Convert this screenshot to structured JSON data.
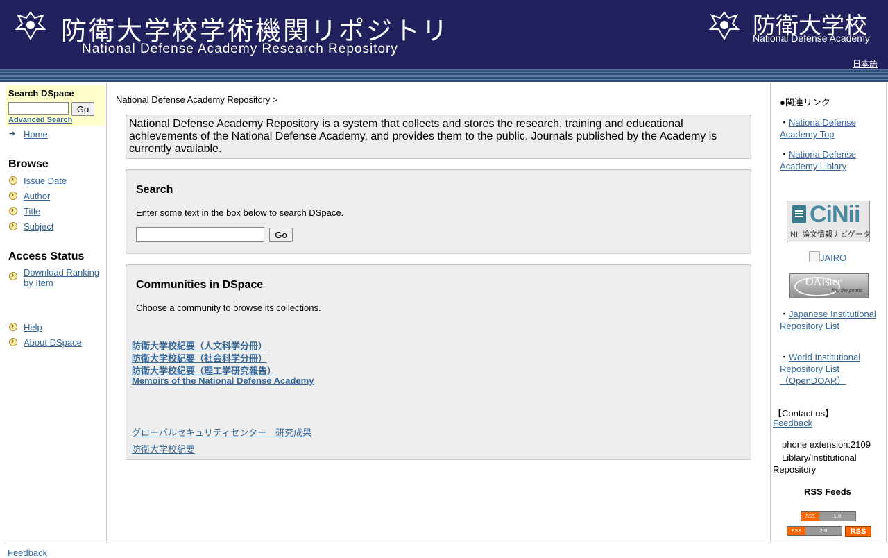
{
  "header": {
    "title_jp": "防衛大学校学術機関リポジトリ",
    "title_en": "National Defense Academy Research Repository",
    "brand_jp": "防衛大学校",
    "brand_en": "National Defense Academy",
    "language_link": "日本語",
    "colors": {
      "background": "#21215e",
      "stripe": "#2e4f7a"
    }
  },
  "left_nav": {
    "search_title": "Search DSpace",
    "search_value": "",
    "go_label": "Go",
    "advanced_search": "Advanced Search",
    "home": "Home",
    "browse_heading": "Browse",
    "browse_items": [
      "Issue Date",
      "Author",
      "Title",
      "Subject"
    ],
    "access_heading": "Access Status",
    "download_ranking_line1": "Download Ranking",
    "download_ranking_line2": " by Item",
    "help": "Help",
    "about": "About DSpace"
  },
  "main": {
    "breadcrumb": "National Defense Academy Repository >",
    "intro": "National Defense Academy Repository is a system that collects and stores the research, training and educational achievements of the National Defense Academy, and provides them to the public. Journals published by the Academy is currently available.",
    "search": {
      "heading": "Search",
      "instructions": "Enter some text in the box below to search DSpace.",
      "value": "",
      "go_label": "Go"
    },
    "communities": {
      "heading": "Communities in DSpace",
      "instructions": "Choose a community to browse its collections.",
      "links": [
        "防衛大学校紀要（人文科学分冊）",
        "防衛大学校紀要（社会科学分冊）",
        "防衛大学校紀要（理工学研究報告）",
        "Memoirs of the National Defense Academy"
      ],
      "other_links": [
        "グローバルセキュリティセンター　研究成果",
        "防衛大学校紀要"
      ]
    }
  },
  "right_side": {
    "related_heading": "●関連リンク",
    "bullet": "・",
    "link1": "Nationa Defense Academy Top",
    "link2": "Nationa Defense Academy Liblary",
    "cinii_brand": "CiNii",
    "cinii_sub": "NII 論文情報ナビゲータ",
    "jairo": "JAIRO",
    "oaister_brand": "OAIster",
    "oaister_tag": "find the pearls",
    "link3": "Japanese Institutional Repository List",
    "link4": "World Institutional Repository List （OpenDOAR）",
    "contact_heading": "【Contact us】",
    "feedback": "Feedback",
    "phone": "phone extension:2109",
    "liblary": "Liblary/Institutional Repository",
    "rss_heading": "RSS Feeds",
    "rss1_left": "RSS",
    "rss1_right": "1.0",
    "rss2_left": "RSS",
    "rss2_right": "2.0",
    "rss_big": "RSS"
  },
  "footer": {
    "feedback": "Feedback"
  }
}
